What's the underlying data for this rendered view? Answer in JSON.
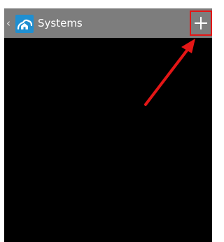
{
  "action_bar": {
    "back_glyph": "‹",
    "app_icon": "cloud-house-icon",
    "title": "Systems",
    "add_icon": "plus-icon"
  },
  "annotation": {
    "highlight_color": "#e41616",
    "arrow_color": "#e41616",
    "target": "add-system-button"
  },
  "colors": {
    "action_bar": "#7d7d7d",
    "content_background": "#000000",
    "app_icon_background": "#1f8fd1"
  }
}
